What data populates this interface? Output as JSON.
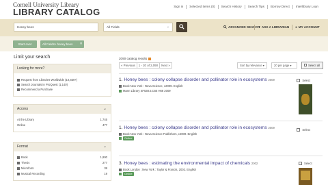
{
  "header": {
    "logo_line1": "Cornell University Library",
    "logo_line2": "LIBRARY CATALOG",
    "topnav": [
      "Sign in",
      "Selected Items (0)",
      "Search History",
      "Search Tips",
      "Borrow Direct",
      "Interlibrary Loan"
    ]
  },
  "search": {
    "query": "Honey bees",
    "field": "All Fields",
    "advanced_label": "ADVANCED SEARCH",
    "ask_label": "ASK A LIBRARIAN",
    "account_label": "MY ACCOUNT"
  },
  "constraints": {
    "start_over": "Start over",
    "chip_label": "All Fields> honey bees",
    "chip_remove": "×"
  },
  "sidebar": {
    "title": "Limit your search",
    "looking": {
      "heading": "Looking for more?",
      "links": [
        "Request from Libraries Worldwide (10,839+)",
        "Search Journals in ProQuest (1,140)",
        "Recommend a Purchase"
      ]
    },
    "access": {
      "heading": "Access",
      "rows": [
        {
          "label": "At the Library",
          "count": "1,745"
        },
        {
          "label": "Online",
          "count": "477"
        }
      ]
    },
    "format": {
      "heading": "Format",
      "rows": [
        {
          "label": "Book",
          "count": "1,900"
        },
        {
          "label": "Thesis",
          "count": "277"
        },
        {
          "label": "Microform",
          "count": "38"
        },
        {
          "label": "Musical Recording",
          "count": "19"
        }
      ]
    }
  },
  "results": {
    "count_text": "2090 catalog results",
    "pager": [
      "« Previous",
      "1 - 20 of 2,090",
      "Next »"
    ],
    "sort_label": "Sort by relevance ▾",
    "perpage_label": "20 per page ▾",
    "select_all": "Select all",
    "items": [
      {
        "num": "1.",
        "title": "Honey bees : colony collapse disorder and pollinator role in ecosystems",
        "year": "2009",
        "line1": "Book   New York : Nova Science, c2009.   English",
        "line2": "Mann Library  SF538.5.C65 H66 2009",
        "select": "Select",
        "online": ""
      },
      {
        "num": "1.",
        "title": "Honey bees : colony collapse disorder and pollinator role in ecosystems",
        "year": "2009",
        "line1": "Book   New York : Nova Science Publishers, c2009.   English",
        "line2": "",
        "select": "Select",
        "online": "Online"
      },
      {
        "num": "3.",
        "title": "Honey bees : estimating the environmental impact of chemicals",
        "year": "2002",
        "line1": "Book   London ; New York : Taylor & Francis, 2002.   English",
        "line2": "",
        "select": "Select",
        "online": "Online"
      }
    ]
  },
  "colors": {
    "search_band": "#ece3c8",
    "chip_green": "#8fb28f",
    "link_blue": "#3a3a8a",
    "online_green": "#5a9a5a"
  }
}
